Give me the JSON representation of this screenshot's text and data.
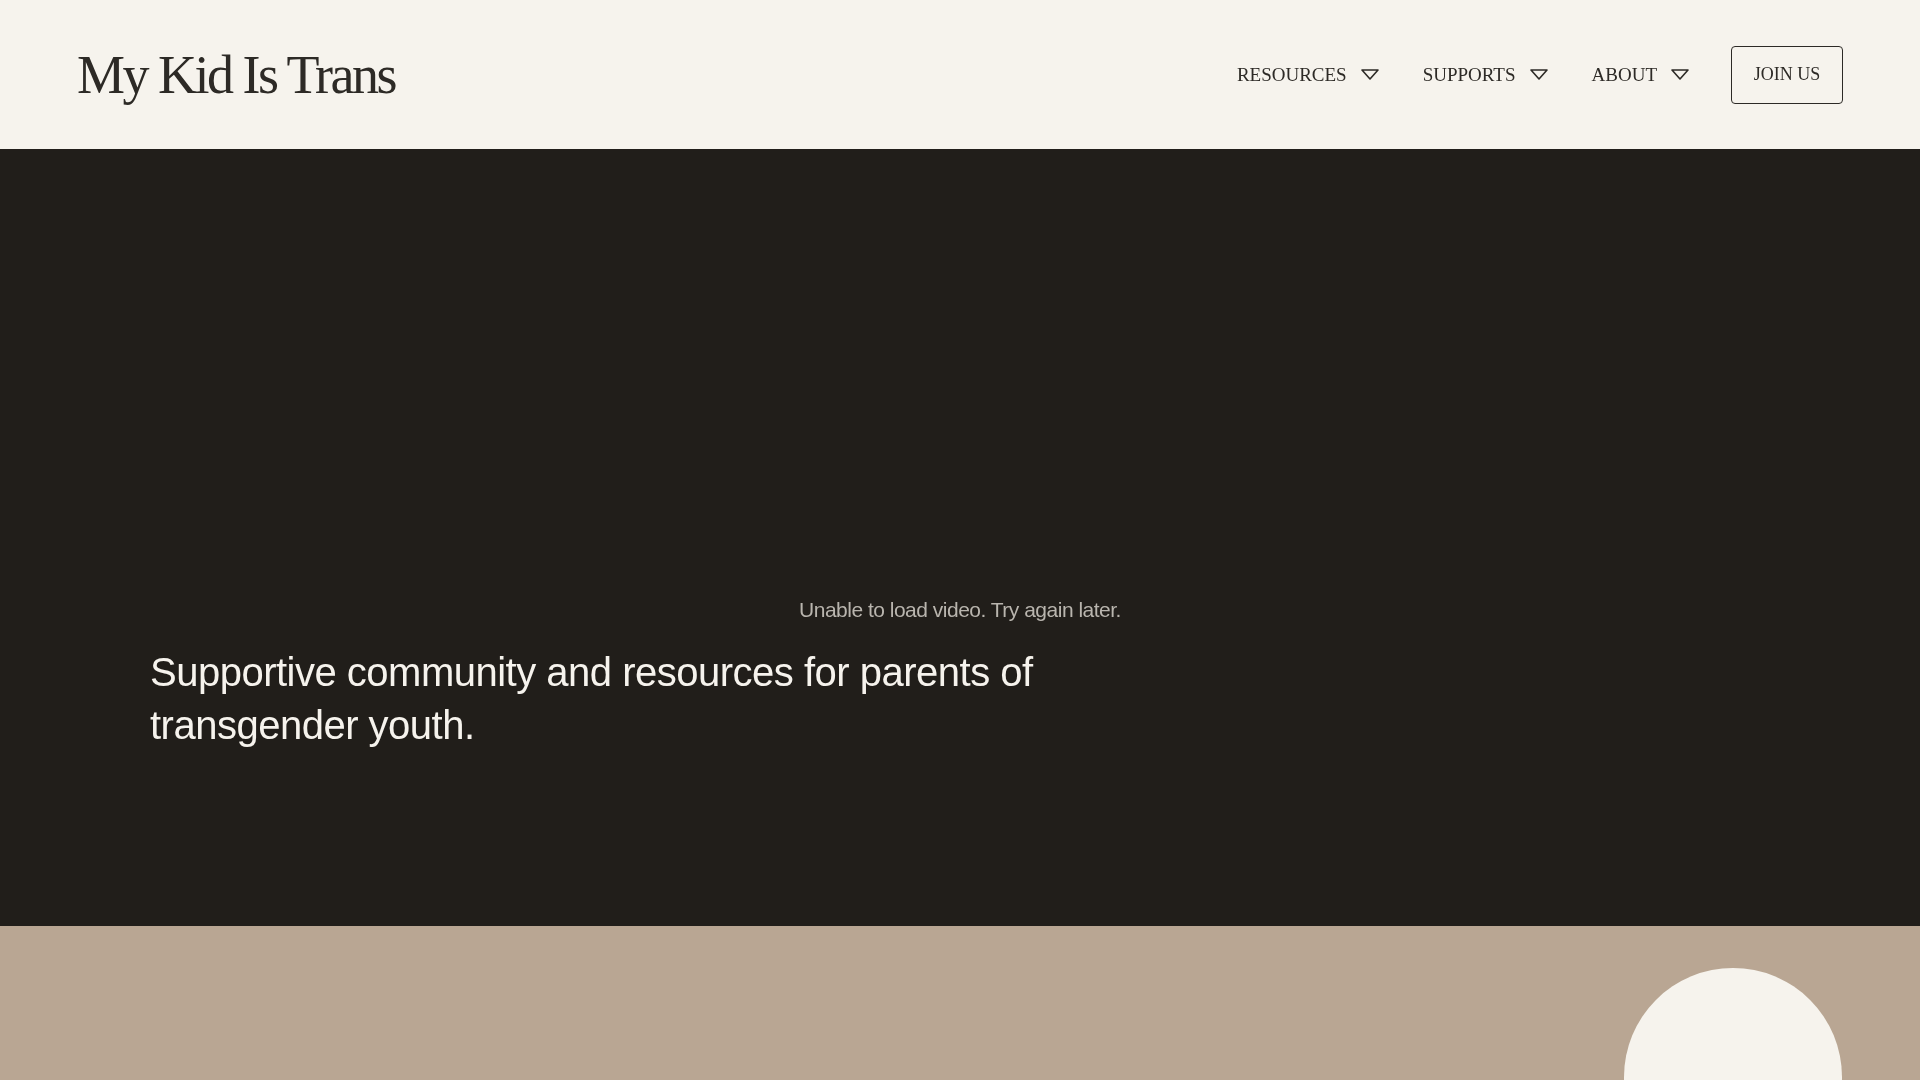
{
  "header": {
    "logo": "My Kid Is Trans",
    "nav": [
      {
        "label": "RESOURCES"
      },
      {
        "label": "SUPPORTS"
      },
      {
        "label": "ABOUT"
      }
    ],
    "cta": "JOIN US"
  },
  "hero": {
    "video_error": "Unable to load video. Try again later.",
    "headline": "Supportive community and resources for parents of transgender youth."
  }
}
